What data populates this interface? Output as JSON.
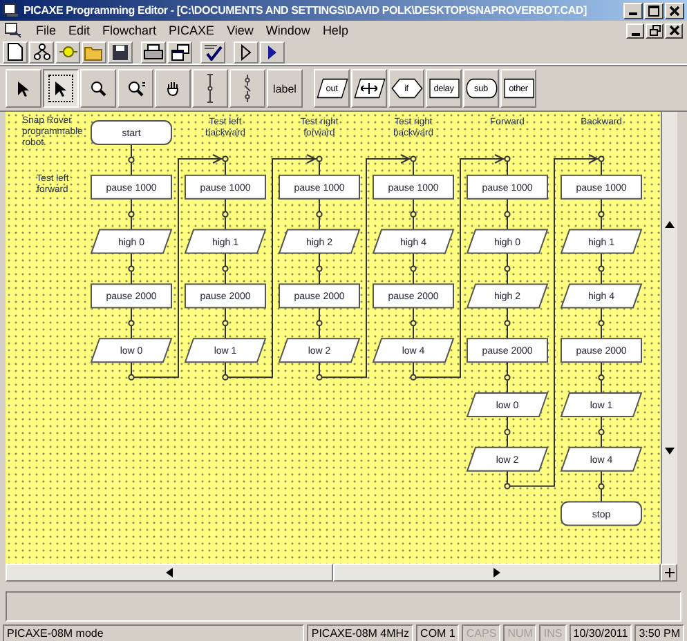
{
  "window": {
    "title": "PICAXE Programming Editor - [C:\\DOCUMENTS AND SETTINGS\\DAVID POLK\\DESKTOP\\SNAPROVERBOT.CAD]"
  },
  "menu": [
    "File",
    "Edit",
    "Flowchart",
    "PICAXE",
    "View",
    "Window",
    "Help"
  ],
  "tools": [
    {
      "selected": false
    },
    {
      "selected": true
    },
    {
      "selected": false
    },
    {
      "selected": false
    },
    {
      "selected": false
    },
    {
      "selected": false
    },
    {
      "selected": false
    },
    {
      "label": "label",
      "selected": false
    }
  ],
  "shape_tools": [
    {
      "kind": "parallelogram",
      "label": "out"
    },
    {
      "kind": "parallelogram"
    },
    {
      "kind": "diamond",
      "label": "if"
    },
    {
      "kind": "rect",
      "label": "delay"
    },
    {
      "kind": "rounded",
      "label": "sub"
    },
    {
      "kind": "rect",
      "label": "other"
    }
  ],
  "flowchart": {
    "comment": "Snap Rover programmable robot.",
    "columns": [
      {
        "label": "Test left forward",
        "steps": [
          {
            "kind": "terminal",
            "text": "start"
          },
          {
            "kind": "process",
            "text": "pause 1000"
          },
          {
            "kind": "output",
            "text": "high 0"
          },
          {
            "kind": "process",
            "text": "pause 2000"
          },
          {
            "kind": "output",
            "text": "low 0"
          }
        ]
      },
      {
        "label": "Test left backward",
        "steps": [
          {
            "kind": "process",
            "text": "pause 1000"
          },
          {
            "kind": "output",
            "text": "high 1"
          },
          {
            "kind": "process",
            "text": "pause 2000"
          },
          {
            "kind": "output",
            "text": "low 1"
          }
        ]
      },
      {
        "label": "Test right forward",
        "steps": [
          {
            "kind": "process",
            "text": "pause 1000"
          },
          {
            "kind": "output",
            "text": "high 2"
          },
          {
            "kind": "process",
            "text": "pause 2000"
          },
          {
            "kind": "output",
            "text": "low 2"
          }
        ]
      },
      {
        "label": "Test right backward",
        "steps": [
          {
            "kind": "process",
            "text": "pause 1000"
          },
          {
            "kind": "output",
            "text": "high 4"
          },
          {
            "kind": "process",
            "text": "pause 2000"
          },
          {
            "kind": "output",
            "text": "low 4"
          }
        ]
      },
      {
        "label": "Forward",
        "steps": [
          {
            "kind": "process",
            "text": "pause 1000"
          },
          {
            "kind": "output",
            "text": "high 0"
          },
          {
            "kind": "output",
            "text": "high 2"
          },
          {
            "kind": "process",
            "text": "pause 2000"
          },
          {
            "kind": "output",
            "text": "low 0"
          },
          {
            "kind": "output",
            "text": "low 2"
          }
        ]
      },
      {
        "label": "Backward",
        "steps": [
          {
            "kind": "process",
            "text": "pause 1000"
          },
          {
            "kind": "output",
            "text": "high 1"
          },
          {
            "kind": "output",
            "text": "high 4"
          },
          {
            "kind": "process",
            "text": "pause 2000"
          },
          {
            "kind": "output",
            "text": "low 1"
          },
          {
            "kind": "output",
            "text": "low 4"
          },
          {
            "kind": "terminal",
            "text": "stop"
          }
        ]
      }
    ]
  },
  "status_bar": [
    {
      "text": "PICAXE-08M mode",
      "disabled": false
    },
    {
      "text": "PICAXE-08M 4MHz",
      "disabled": false
    },
    {
      "text": "COM 1",
      "disabled": false
    },
    {
      "text": "CAPS",
      "disabled": true
    },
    {
      "text": "NUM",
      "disabled": true
    },
    {
      "text": "INS",
      "disabled": true
    },
    {
      "text": "10/30/2011",
      "disabled": false
    },
    {
      "text": "3:50 PM",
      "disabled": false
    }
  ]
}
